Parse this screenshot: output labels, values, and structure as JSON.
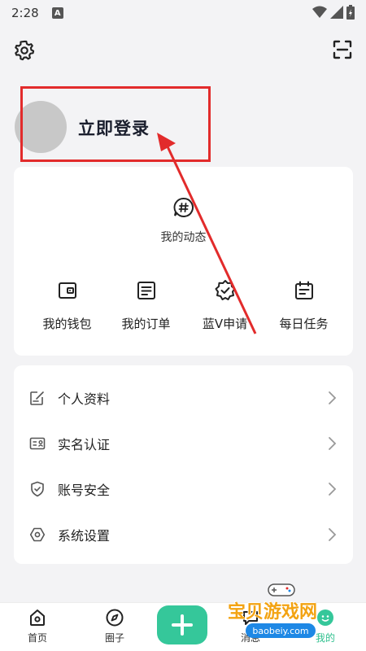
{
  "status_bar": {
    "time": "2:28",
    "notification_badge": "A"
  },
  "header": {
    "settings_icon": "gear-icon",
    "scan_icon": "scan-icon"
  },
  "profile": {
    "login_label": "立即登录"
  },
  "activity": {
    "label": "我的动态",
    "icon": "hashtag-bubble-icon"
  },
  "quick_actions": [
    {
      "label": "我的钱包",
      "icon": "wallet-icon"
    },
    {
      "label": "我的订单",
      "icon": "order-icon"
    },
    {
      "label": "蓝V申请",
      "icon": "verified-badge-icon"
    },
    {
      "label": "每日任务",
      "icon": "calendar-task-icon"
    }
  ],
  "menu": [
    {
      "label": "个人资料",
      "icon": "edit-doc-icon"
    },
    {
      "label": "实名认证",
      "icon": "id-card-icon"
    },
    {
      "label": "账号安全",
      "icon": "shield-icon"
    },
    {
      "label": "系统设置",
      "icon": "hexagon-settings-icon"
    }
  ],
  "tabbar": {
    "tabs": [
      {
        "label": "首页",
        "icon": "home-icon"
      },
      {
        "label": "圈子",
        "icon": "compass-icon"
      },
      {
        "label": "消息",
        "icon": "message-icon"
      },
      {
        "label": "我的",
        "icon": "profile-icon"
      }
    ],
    "active_tab": "我的",
    "plus_icon": "plus-icon"
  },
  "watermark": {
    "title": "宝贝游戏网",
    "url": "baobeiy.com"
  },
  "colors": {
    "accent": "#35c79a",
    "highlight_red": "#e22b2b",
    "background": "#f3f3f5"
  }
}
